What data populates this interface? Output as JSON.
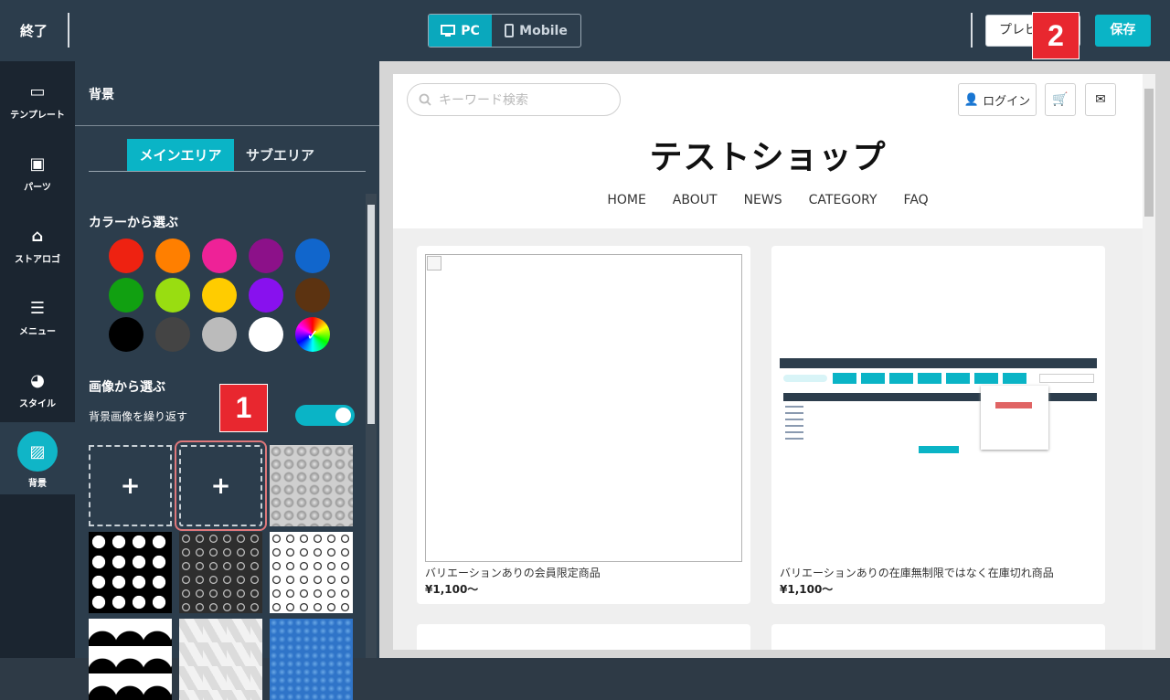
{
  "topbar": {
    "exit_label": "終了",
    "device_pc": "PC",
    "device_mobile": "Mobile",
    "preview_label": "プレビ",
    "save_label": "保存"
  },
  "badges": {
    "one": "1",
    "two": "2"
  },
  "leftnav": [
    {
      "label": "テンプレート",
      "icon": "template-icon"
    },
    {
      "label": "パーツ",
      "icon": "parts-toolbox-icon"
    },
    {
      "label": "ストアロゴ",
      "icon": "store-icon"
    },
    {
      "label": "メニュー",
      "icon": "menu-list-icon"
    },
    {
      "label": "スタイル",
      "icon": "palette-icon"
    },
    {
      "label": "背景",
      "icon": "background-stripes-icon"
    }
  ],
  "panel": {
    "title": "背景",
    "tab_main": "メインエリア",
    "tab_sub": "サブエリア",
    "color_section": "カラーから選ぶ",
    "image_section": "画像から選ぶ",
    "repeat_label": "背景画像を繰り返す",
    "repeat_on": true,
    "add_symbol": "+",
    "colors": [
      "#ee2211",
      "#ff7f00",
      "#ee2297",
      "#8c1189",
      "#1166cc",
      "#11a011",
      "#99dd11",
      "#ffcc00",
      "#8811ee",
      "#5c3311",
      "#000000",
      "#444444",
      "#bbbbbb",
      "#ffffff",
      "rainbow"
    ]
  },
  "site": {
    "search_placeholder": "キーワード検索",
    "login_label": "ログイン",
    "shop_name": "テストショップ",
    "menu": [
      "HOME",
      "ABOUT",
      "NEWS",
      "CATEGORY",
      "FAQ"
    ],
    "products": [
      {
        "name": "バリエーションありの会員限定商品",
        "price": "¥1,100〜"
      },
      {
        "name": "バリエーションありの在庫無制限ではなく在庫切れ商品",
        "price": "¥1,100〜"
      }
    ]
  }
}
